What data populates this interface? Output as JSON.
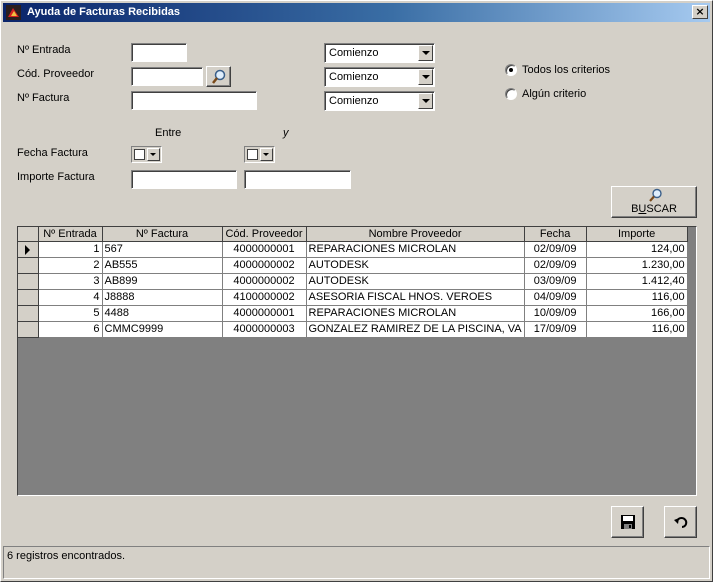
{
  "window": {
    "title": "Ayuda de Facturas Recibidas",
    "close_label": "×"
  },
  "form": {
    "entrada_label": "Nº Entrada",
    "proveedor_label": "Cód. Proveedor",
    "factura_label": "Nº Factura",
    "entrada_value": "",
    "proveedor_value": "",
    "factura_value": "",
    "match_modes": [
      "Comienzo",
      "Comienzo",
      "Comienzo"
    ],
    "entre_label": "Entre",
    "y_label": "y",
    "fecha_label": "Fecha Factura",
    "importe_label": "Importe Factura",
    "importe_from": "",
    "importe_to": ""
  },
  "criteria": {
    "options": [
      "Todos los criterios",
      "Algún criterio"
    ],
    "selected": "Todos los criterios"
  },
  "search_button": {
    "label_pre": "B",
    "label_u": "U",
    "label_post": "SCAR",
    "icon": "magnifier-icon"
  },
  "grid": {
    "columns": [
      "Nº Entrada",
      "Nº Factura",
      "Cód. Proveedor",
      "Nombre Proveedor",
      "Fecha",
      "Importe"
    ],
    "rows": [
      {
        "entrada": "1",
        "factura": "567",
        "proveedor": "4000000001",
        "nombre": "REPARACIONES MICROLAN",
        "fecha": "02/09/09",
        "importe": "124,00"
      },
      {
        "entrada": "2",
        "factura": "AB555",
        "proveedor": "4000000002",
        "nombre": "AUTODESK",
        "fecha": "02/09/09",
        "importe": "1.230,00"
      },
      {
        "entrada": "3",
        "factura": "AB899",
        "proveedor": "4000000002",
        "nombre": "AUTODESK",
        "fecha": "03/09/09",
        "importe": "1.412,40"
      },
      {
        "entrada": "4",
        "factura": "J8888",
        "proveedor": "4100000002",
        "nombre": "ASESORIA FISCAL HNOS. VEROES",
        "fecha": "04/09/09",
        "importe": "116,00"
      },
      {
        "entrada": "5",
        "factura": "4488",
        "proveedor": "4000000001",
        "nombre": "REPARACIONES MICROLAN",
        "fecha": "10/09/09",
        "importe": "166,00"
      },
      {
        "entrada": "6",
        "factura": "CMMC9999",
        "proveedor": "4000000003",
        "nombre": "GONZALEZ RAMIREZ DE LA PISCINA, VA",
        "fecha": "17/09/09",
        "importe": "116,00"
      }
    ]
  },
  "footer_buttons": {
    "save_icon": "floppy-disk-icon",
    "undo_icon": "undo-arrow-icon"
  },
  "status": {
    "text": "6 registros encontrados."
  },
  "colors": {
    "title_start": "#0a246a",
    "title_end": "#a6caf0",
    "face": "#d4d0c8"
  }
}
